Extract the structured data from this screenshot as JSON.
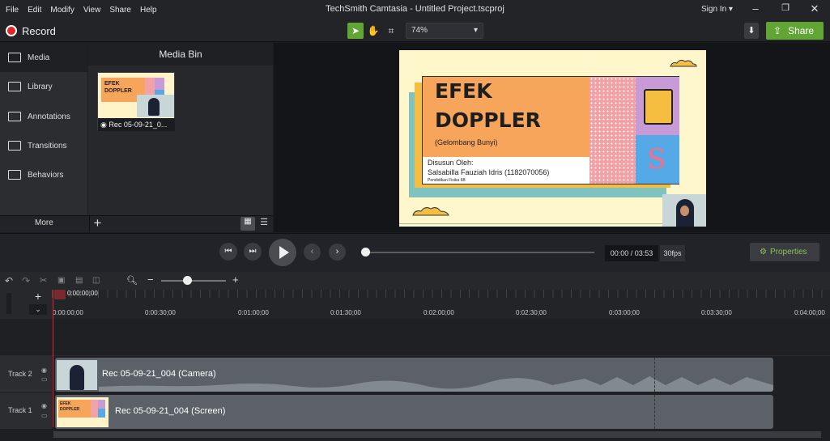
{
  "menu": [
    "File",
    "Edit",
    "Modify",
    "View",
    "Share",
    "Help"
  ],
  "window_title": "TechSmith Camtasia - Untitled Project.tscproj",
  "signin": "Sign In",
  "record_label": "Record",
  "zoom": "74%",
  "share_label": "Share",
  "sidebar": [
    "Media",
    "Library",
    "Annotations",
    "Transitions",
    "Behaviors"
  ],
  "more_label": "More",
  "media_bin_title": "Media Bin",
  "media_item": "Rec 05-09-21_0...",
  "slide": {
    "title1": "EFEK",
    "title2": "DOPPLER",
    "subtitle": "(Gelombang Bunyi)",
    "by": "Disusun Oleh:",
    "author": "Salsabilla Fauziah Idris (1182070056)",
    "dept": "Pendidikan Fisika 6B"
  },
  "thumb": {
    "t1": "EFEK",
    "t2": "DOPPLER"
  },
  "time": "00:00 / 03:53",
  "fps": "30fps",
  "properties": "Properties",
  "playhead_time": "0:00:00;00",
  "ruler": [
    "0:00:00;00",
    "0:00:30;00",
    "0:01:00;00",
    "0:01:30;00",
    "0:02:00;00",
    "0:02:30;00",
    "0:03:00;00",
    "0:03:30;00",
    "0:04:00;00"
  ],
  "tracks": [
    {
      "label": "Track 2",
      "clip": "Rec 05-09-21_004 (Camera)"
    },
    {
      "label": "Track 1",
      "clip": "Rec 05-09-21_004 (Screen)"
    }
  ],
  "colors": {
    "accent": "#61a534",
    "record": "#e0262c",
    "slide_orange": "#f8a55c",
    "slide_pink": "#f2a1a6",
    "slide_purple": "#c99bd6",
    "slide_blue": "#55a9e6"
  }
}
